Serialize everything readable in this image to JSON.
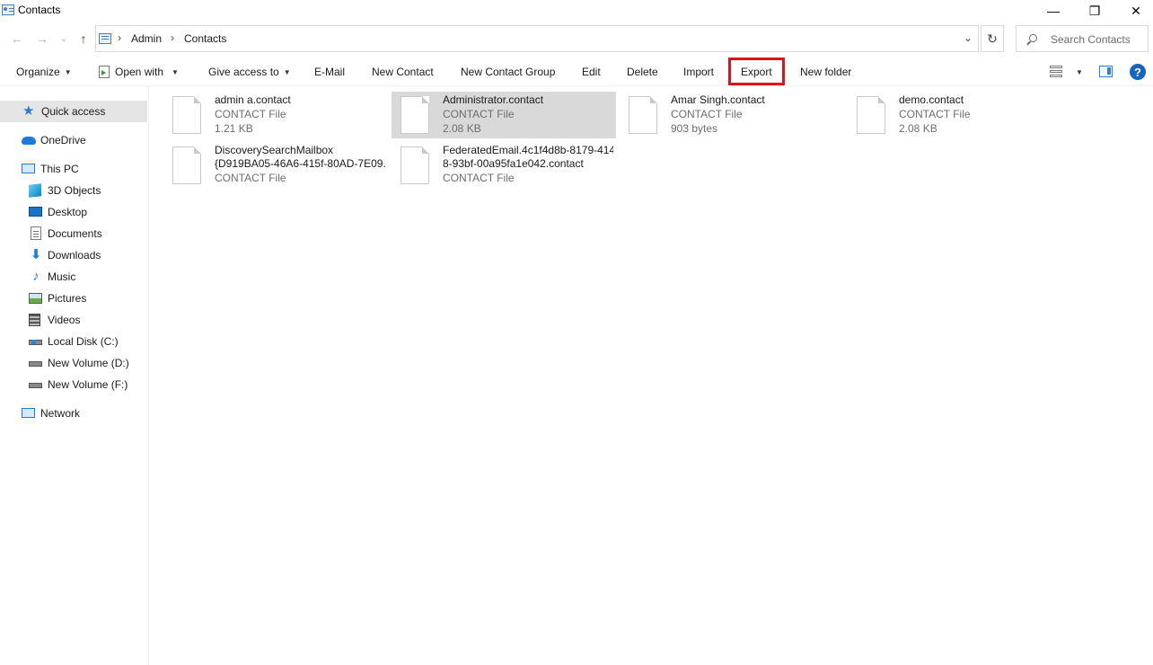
{
  "window": {
    "title": "Contacts",
    "minimize_glyph": "—",
    "restore_glyph": "❐",
    "close_glyph": "✕"
  },
  "nav": {
    "back_glyph": "←",
    "forward_glyph": "→",
    "recent_glyph": "⌄",
    "up_glyph": "↑"
  },
  "address": {
    "crumbs": [
      "Admin",
      "Contacts"
    ],
    "sep": "›",
    "dropdown_glyph": "⌄",
    "refresh_glyph": "↻"
  },
  "search": {
    "placeholder": "Search Contacts"
  },
  "commands": {
    "organize": "Organize",
    "open_with": "Open with",
    "give_access": "Give access to",
    "email": "E-Mail",
    "new_contact": "New Contact",
    "new_contact_group": "New Contact Group",
    "edit": "Edit",
    "delete": "Delete",
    "import": "Import",
    "export": "Export",
    "new_folder": "New folder",
    "caret": "▼",
    "help": "?"
  },
  "highlight_color": "#e0101c",
  "sidebar": {
    "items": [
      {
        "label": "Quick access",
        "icon": "quick-access-star-icon"
      },
      {
        "label": "OneDrive",
        "icon": "onedrive-cloud-icon"
      },
      {
        "label": "This PC",
        "icon": "this-pc-icon"
      },
      {
        "label": "3D Objects",
        "icon": "3d-objects-icon"
      },
      {
        "label": "Desktop",
        "icon": "desktop-icon"
      },
      {
        "label": "Documents",
        "icon": "documents-icon"
      },
      {
        "label": "Downloads",
        "icon": "downloads-icon"
      },
      {
        "label": "Music",
        "icon": "music-icon"
      },
      {
        "label": "Pictures",
        "icon": "pictures-icon"
      },
      {
        "label": "Videos",
        "icon": "videos-icon"
      },
      {
        "label": "Local Disk (C:)",
        "icon": "local-disk-icon"
      },
      {
        "label": "New Volume (D:)",
        "icon": "drive-icon"
      },
      {
        "label": "New Volume (F:)",
        "icon": "drive-icon"
      },
      {
        "label": "Network",
        "icon": "network-icon"
      }
    ],
    "glyphs": {
      "star": "★",
      "download": "⬇",
      "music": "♪"
    }
  },
  "files": [
    {
      "name": "admin a.contact",
      "type": "CONTACT File",
      "size": "1.21 KB"
    },
    {
      "name": "Administrator.contact",
      "type": "CONTACT File",
      "size": "2.08 KB"
    },
    {
      "name": "Amar Singh.contact",
      "type": "CONTACT File",
      "size": "903 bytes"
    },
    {
      "name": "demo.contact",
      "type": "CONTACT File",
      "size": "2.08 KB"
    },
    {
      "name": "DiscoverySearchMailbox",
      "name2": "{D919BA05-46A6-415f-80AD-7E09...",
      "type": "CONTACT File"
    },
    {
      "name": "FederatedEmail.4c1f4d8b-8179-414",
      "name2": "8-93bf-00a95fa1e042.contact",
      "type": "CONTACT File"
    }
  ]
}
